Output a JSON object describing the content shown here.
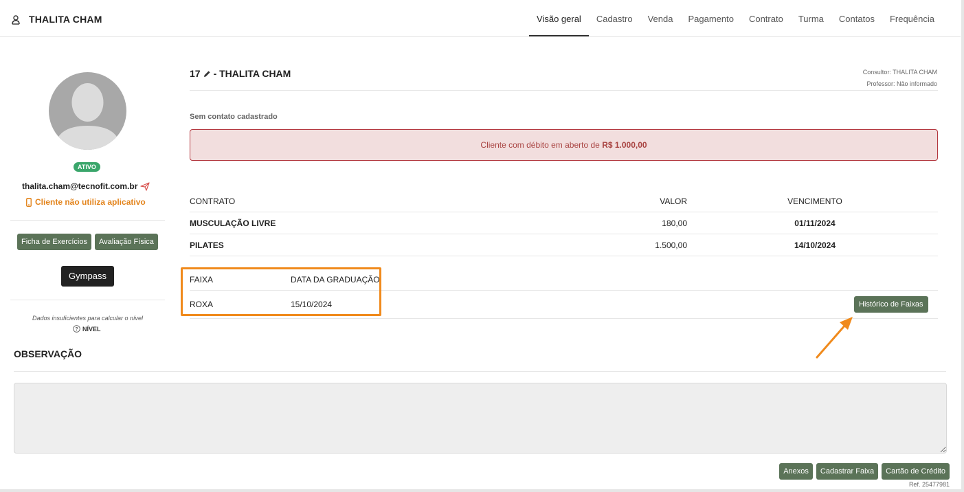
{
  "header": {
    "client_name": "THALITA CHAM",
    "tabs": [
      "Visão geral",
      "Cadastro",
      "Venda",
      "Pagamento",
      "Contrato",
      "Turma",
      "Contatos",
      "Frequência"
    ],
    "active_tab": "Visão geral"
  },
  "profile": {
    "status": "ATIVO",
    "email": "thalita.cham@tecnofit.com.br",
    "app_status": "Cliente não utiliza aplicativo",
    "buttons": {
      "ficha": "Ficha de Exercícios",
      "avaliacao": "Avaliação Física"
    },
    "gympass": "Gympass",
    "nivel_note": "Dados insuficientes para calcular o nível",
    "nivel_label": "NÍVEL"
  },
  "main": {
    "contract_number": "17",
    "contract_name": "- THALITA CHAM",
    "consultor": "Consultor: THALITA CHAM",
    "professor": "Professor: Não informado",
    "sem_contato": "Sem contato cadastrado",
    "alert_text": "Cliente com débito em aberto de",
    "alert_value": "R$ 1.000,00"
  },
  "contracts": {
    "headers": {
      "contrato": "CONTRATO",
      "valor": "VALOR",
      "vencimento": "VENCIMENTO"
    },
    "rows": [
      {
        "contrato": "MUSCULAÇÃO LIVRE",
        "valor": "180,00",
        "vencimento": "01/11/2024"
      },
      {
        "contrato": "PILATES",
        "valor": "1.500,00",
        "vencimento": "14/10/2024"
      }
    ]
  },
  "faixa": {
    "headers": {
      "faixa": "FAIXA",
      "data": "DATA DA GRADUAÇÃO"
    },
    "row": {
      "faixa": "ROXA",
      "data": "15/10/2024"
    },
    "historico_button": "Histórico de Faixas"
  },
  "observacao": {
    "title": "OBSERVAÇÃO"
  },
  "footer": {
    "buttons": {
      "anexos": "Anexos",
      "cadastrar_faixa": "Cadastrar Faixa",
      "cartao": "Cartão de Crédito"
    },
    "ref": "Ref. 25477981"
  },
  "colors": {
    "accent_green": "#5b7358",
    "status_green": "#3aa66b",
    "warning_orange": "#e3841c",
    "alert_bg": "#f2dede",
    "alert_text": "#a94442",
    "highlight": "#f08a1c"
  },
  "icons": [
    "user-icon",
    "pencil-icon",
    "send-icon",
    "phone-icon",
    "help-circle-icon",
    "arrow-icon"
  ]
}
